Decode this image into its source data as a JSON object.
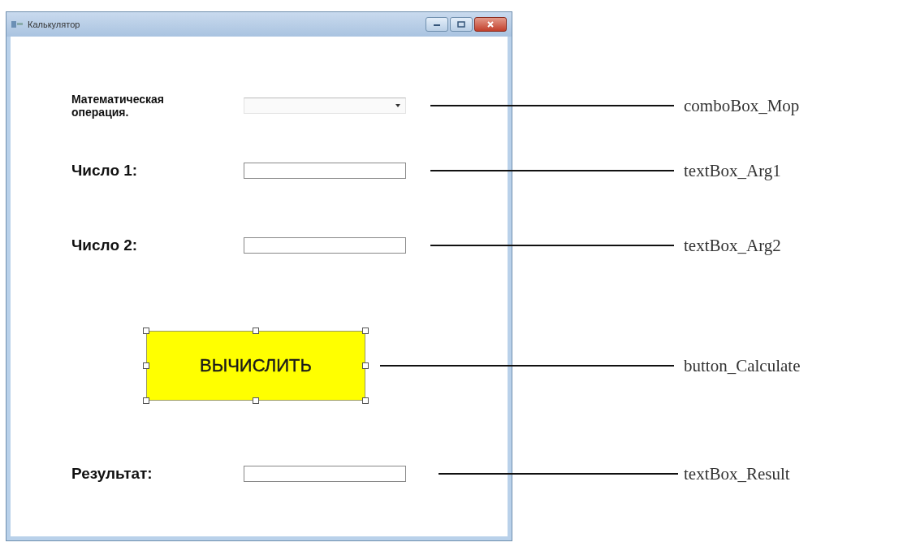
{
  "window": {
    "title": "Калькулятор"
  },
  "controls": [
    {
      "kind": "combo",
      "label": "Математическая операция.",
      "annotation": "comboBox_Mop",
      "selected": false
    },
    {
      "kind": "text",
      "label": "Число 1:",
      "annotation": "textBox_Arg1",
      "selected": false
    },
    {
      "kind": "text",
      "label": "Число 2:",
      "annotation": "textBox_Arg2",
      "selected": false
    },
    {
      "kind": "button",
      "text": "ВЫЧИСЛИТЬ",
      "annotation": "button_Calculate",
      "selected": true
    },
    {
      "kind": "text",
      "label": "Результат:",
      "annotation": "textBox_Result",
      "selected": false
    }
  ]
}
